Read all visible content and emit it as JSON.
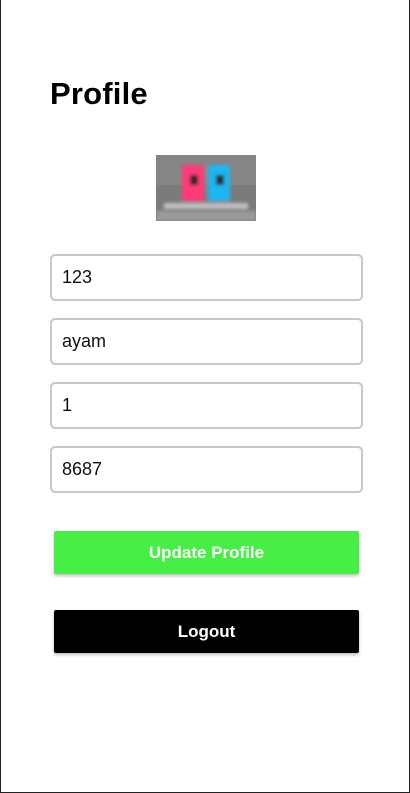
{
  "header": {
    "title": "Profile"
  },
  "avatar": {
    "alt": "profile picture"
  },
  "form": {
    "field_1": {
      "value": "123"
    },
    "field_2": {
      "value": "ayam"
    },
    "field_3": {
      "value": "1"
    },
    "field_4": {
      "value": "8687"
    }
  },
  "actions": {
    "update_label": "Update Profile",
    "logout_label": "Logout"
  },
  "colors": {
    "update_button": "#46ee46",
    "logout_button": "#000000"
  }
}
